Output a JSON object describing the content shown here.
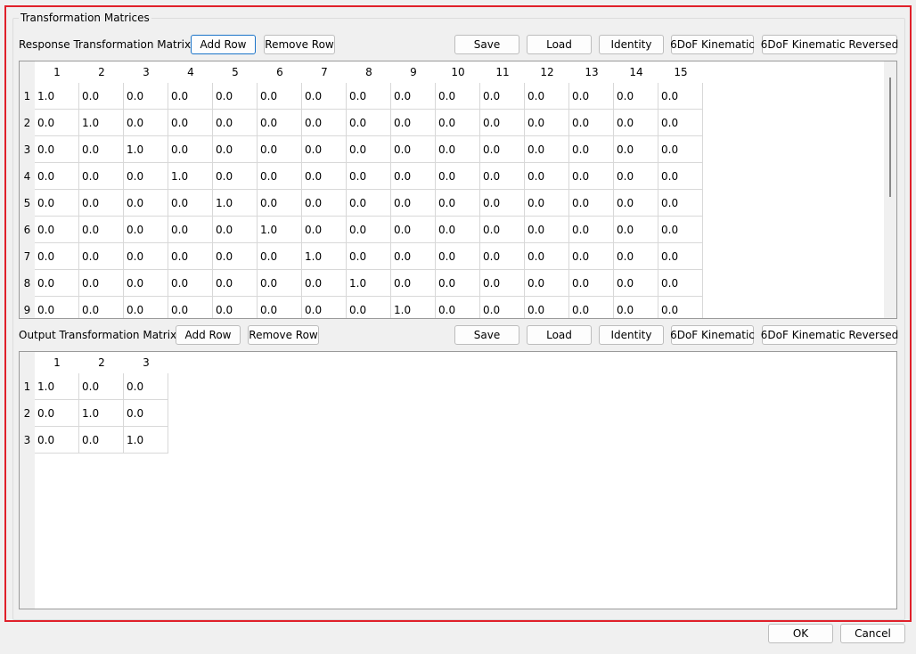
{
  "group_title": "Transformation Matrices",
  "response": {
    "label": "Response Transformation Matrix",
    "add_row": "Add Row",
    "remove_row": "Remove Row",
    "save": "Save",
    "load": "Load",
    "identity": "Identity",
    "kinematic": "6DoF Kinematic",
    "kinematic_reversed": "6DoF Kinematic Reversed",
    "columns": [
      "1",
      "2",
      "3",
      "4",
      "5",
      "6",
      "7",
      "8",
      "9",
      "10",
      "11",
      "12",
      "13",
      "14",
      "15"
    ],
    "row_labels": [
      "1",
      "2",
      "3",
      "4",
      "5",
      "6",
      "7",
      "8",
      "9"
    ],
    "rows": [
      [
        "1.0",
        "0.0",
        "0.0",
        "0.0",
        "0.0",
        "0.0",
        "0.0",
        "0.0",
        "0.0",
        "0.0",
        "0.0",
        "0.0",
        "0.0",
        "0.0",
        "0.0"
      ],
      [
        "0.0",
        "1.0",
        "0.0",
        "0.0",
        "0.0",
        "0.0",
        "0.0",
        "0.0",
        "0.0",
        "0.0",
        "0.0",
        "0.0",
        "0.0",
        "0.0",
        "0.0"
      ],
      [
        "0.0",
        "0.0",
        "1.0",
        "0.0",
        "0.0",
        "0.0",
        "0.0",
        "0.0",
        "0.0",
        "0.0",
        "0.0",
        "0.0",
        "0.0",
        "0.0",
        "0.0"
      ],
      [
        "0.0",
        "0.0",
        "0.0",
        "1.0",
        "0.0",
        "0.0",
        "0.0",
        "0.0",
        "0.0",
        "0.0",
        "0.0",
        "0.0",
        "0.0",
        "0.0",
        "0.0"
      ],
      [
        "0.0",
        "0.0",
        "0.0",
        "0.0",
        "1.0",
        "0.0",
        "0.0",
        "0.0",
        "0.0",
        "0.0",
        "0.0",
        "0.0",
        "0.0",
        "0.0",
        "0.0"
      ],
      [
        "0.0",
        "0.0",
        "0.0",
        "0.0",
        "0.0",
        "1.0",
        "0.0",
        "0.0",
        "0.0",
        "0.0",
        "0.0",
        "0.0",
        "0.0",
        "0.0",
        "0.0"
      ],
      [
        "0.0",
        "0.0",
        "0.0",
        "0.0",
        "0.0",
        "0.0",
        "1.0",
        "0.0",
        "0.0",
        "0.0",
        "0.0",
        "0.0",
        "0.0",
        "0.0",
        "0.0"
      ],
      [
        "0.0",
        "0.0",
        "0.0",
        "0.0",
        "0.0",
        "0.0",
        "0.0",
        "1.0",
        "0.0",
        "0.0",
        "0.0",
        "0.0",
        "0.0",
        "0.0",
        "0.0"
      ],
      [
        "0.0",
        "0.0",
        "0.0",
        "0.0",
        "0.0",
        "0.0",
        "0.0",
        "0.0",
        "1.0",
        "0.0",
        "0.0",
        "0.0",
        "0.0",
        "0.0",
        "0.0"
      ]
    ]
  },
  "output": {
    "label": "Output Transformation Matrix",
    "add_row": "Add Row",
    "remove_row": "Remove Row",
    "save": "Save",
    "load": "Load",
    "identity": "Identity",
    "kinematic": "6DoF Kinematic",
    "kinematic_reversed": "6DoF Kinematic Reversed",
    "columns": [
      "1",
      "2",
      "3"
    ],
    "row_labels": [
      "1",
      "2",
      "3"
    ],
    "rows": [
      [
        "1.0",
        "0.0",
        "0.0"
      ],
      [
        "0.0",
        "1.0",
        "0.0"
      ],
      [
        "0.0",
        "0.0",
        "1.0"
      ]
    ]
  },
  "dialog": {
    "ok": "OK",
    "cancel": "Cancel"
  },
  "colors": {
    "highlight_border": "#e0202a",
    "focus_border": "#1a73c8"
  }
}
